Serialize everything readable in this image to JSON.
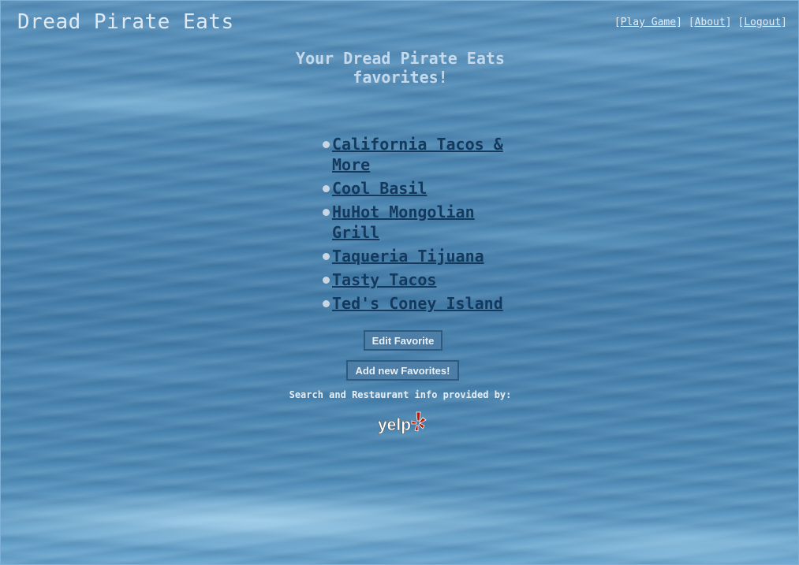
{
  "header": {
    "title": "Dread Pirate Eats",
    "nav": [
      {
        "label": "Play Game"
      },
      {
        "label": "About"
      },
      {
        "label": "Logout"
      }
    ]
  },
  "main": {
    "heading": "Your Dread Pirate Eats favorites!",
    "favorites": [
      {
        "name": "California Tacos & More"
      },
      {
        "name": "Cool Basil"
      },
      {
        "name": "HuHot Mongolian Grill"
      },
      {
        "name": "Taqueria Tijuana"
      },
      {
        "name": "Tasty Tacos"
      },
      {
        "name": "Ted's Coney Island"
      }
    ],
    "buttons": {
      "edit_label": "Edit Favorite",
      "add_label": "Add new Favorites!"
    },
    "credit_text": "Search and Restaurant info provided by:",
    "logo": {
      "name": "yelp-logo",
      "text": "yelp",
      "burst_color": "#c41200"
    }
  },
  "colors": {
    "link": "#14395c",
    "heading": "#c5d9ea",
    "ocean": "#4d88b3"
  }
}
